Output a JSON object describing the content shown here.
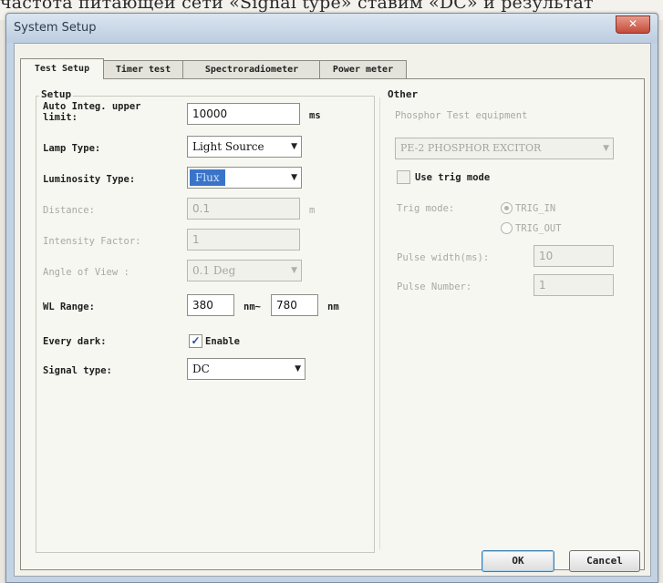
{
  "background_text": "частота питающей сети «Signal type» ставим «DC» и результат",
  "window": {
    "title": "System Setup",
    "close_label": "✕"
  },
  "tabs": [
    {
      "label": "Test Setup",
      "active": true
    },
    {
      "label": "Timer test",
      "active": false
    },
    {
      "label": "Spectroradiometer",
      "active": false
    },
    {
      "label": "Power meter",
      "active": false
    }
  ],
  "setup": {
    "group_title": "Setup",
    "auto_integ": {
      "label": "Auto Integ. upper limit:",
      "value": "10000",
      "unit": "ms"
    },
    "lamp_type": {
      "label": "Lamp Type:",
      "value": "Light Source"
    },
    "luminosity_type": {
      "label": "Luminosity Type:",
      "value": "Flux"
    },
    "distance": {
      "label": "Distance:",
      "value": "0.1",
      "unit": "m"
    },
    "intensity_factor": {
      "label": "Intensity Factor:",
      "value": "1"
    },
    "angle_of_view": {
      "label": "Angle of View :",
      "value": "0.1 Deg"
    },
    "wl_range": {
      "label": "WL Range:",
      "from": "380",
      "from_unit": "nm~",
      "to": "780",
      "to_unit": "nm"
    },
    "every_dark": {
      "label": "Every dark:",
      "checkbox_label": "Enable",
      "checked": true
    },
    "signal_type": {
      "label": "Signal type:",
      "value": "DC"
    }
  },
  "other": {
    "group_title": "Other",
    "phosphor_label": "Phosphor Test equipment",
    "phosphor_value": "PE-2 PHOSPHOR EXCITOR",
    "use_trig_label": "Use trig mode",
    "use_trig_checked": false,
    "trig_mode_label": "Trig mode:",
    "trig_in_label": "TRIG_IN",
    "trig_out_label": "TRIG_OUT",
    "trig_selected": "TRIG_IN",
    "pulse_width_label": "Pulse width(ms):",
    "pulse_width_value": "10",
    "pulse_number_label": "Pulse Number:",
    "pulse_number_value": "1"
  },
  "buttons": {
    "ok": "OK",
    "cancel": "Cancel"
  }
}
